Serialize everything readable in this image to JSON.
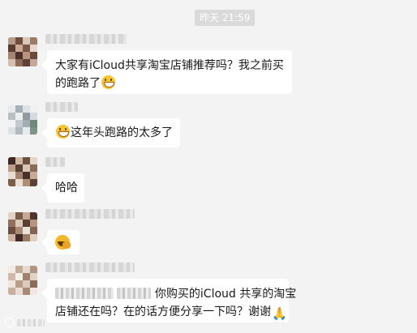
{
  "timestamp": "昨天 21:59",
  "messages": [
    {
      "line1": "大家有iCloud共享淘宝店铺推荐吗？我之前买",
      "line2": "的跑路了"
    },
    {
      "text": "这年头跑路的太多了"
    },
    {
      "text": "哈哈"
    },
    {
      "sticker": "grinning-sweat-sticker"
    },
    {
      "line1_suffix": "你购买的iCloud 共享的淘宝",
      "line2": "店铺还在吗？在的话方便分享一下吗？谢谢"
    }
  ],
  "watermark": {
    "icon": "camera-icon"
  },
  "colors": {
    "background": "#f3f3f3",
    "bubble": "#ffffff",
    "text": "#191919",
    "time_badge": "#dadada"
  }
}
